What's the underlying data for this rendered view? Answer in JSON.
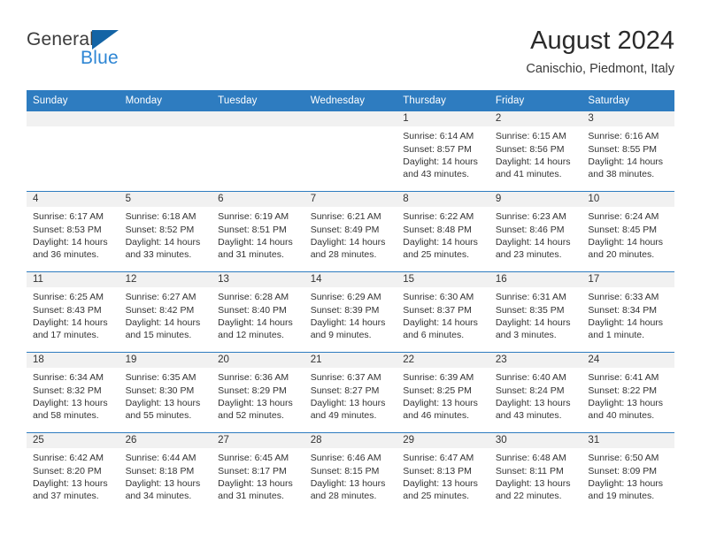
{
  "brand": {
    "word1": "General",
    "word2": "Blue",
    "triangle_color": "#1464a5"
  },
  "header": {
    "title": "August 2024",
    "subtitle": "Canischio, Piedmont, Italy"
  },
  "theme": {
    "header_blue": "#2e7cc0",
    "daynum_strip": "#f1f1f1",
    "text": "#333333"
  },
  "weekdays": [
    "Sunday",
    "Monday",
    "Tuesday",
    "Wednesday",
    "Thursday",
    "Friday",
    "Saturday"
  ],
  "weeks": [
    [
      {
        "empty": true
      },
      {
        "empty": true
      },
      {
        "empty": true
      },
      {
        "empty": true
      },
      {
        "day": "1",
        "sunrise": "Sunrise: 6:14 AM",
        "sunset": "Sunset: 8:57 PM",
        "daylight1": "Daylight: 14 hours",
        "daylight2": "and 43 minutes."
      },
      {
        "day": "2",
        "sunrise": "Sunrise: 6:15 AM",
        "sunset": "Sunset: 8:56 PM",
        "daylight1": "Daylight: 14 hours",
        "daylight2": "and 41 minutes."
      },
      {
        "day": "3",
        "sunrise": "Sunrise: 6:16 AM",
        "sunset": "Sunset: 8:55 PM",
        "daylight1": "Daylight: 14 hours",
        "daylight2": "and 38 minutes."
      }
    ],
    [
      {
        "day": "4",
        "sunrise": "Sunrise: 6:17 AM",
        "sunset": "Sunset: 8:53 PM",
        "daylight1": "Daylight: 14 hours",
        "daylight2": "and 36 minutes."
      },
      {
        "day": "5",
        "sunrise": "Sunrise: 6:18 AM",
        "sunset": "Sunset: 8:52 PM",
        "daylight1": "Daylight: 14 hours",
        "daylight2": "and 33 minutes."
      },
      {
        "day": "6",
        "sunrise": "Sunrise: 6:19 AM",
        "sunset": "Sunset: 8:51 PM",
        "daylight1": "Daylight: 14 hours",
        "daylight2": "and 31 minutes."
      },
      {
        "day": "7",
        "sunrise": "Sunrise: 6:21 AM",
        "sunset": "Sunset: 8:49 PM",
        "daylight1": "Daylight: 14 hours",
        "daylight2": "and 28 minutes."
      },
      {
        "day": "8",
        "sunrise": "Sunrise: 6:22 AM",
        "sunset": "Sunset: 8:48 PM",
        "daylight1": "Daylight: 14 hours",
        "daylight2": "and 25 minutes."
      },
      {
        "day": "9",
        "sunrise": "Sunrise: 6:23 AM",
        "sunset": "Sunset: 8:46 PM",
        "daylight1": "Daylight: 14 hours",
        "daylight2": "and 23 minutes."
      },
      {
        "day": "10",
        "sunrise": "Sunrise: 6:24 AM",
        "sunset": "Sunset: 8:45 PM",
        "daylight1": "Daylight: 14 hours",
        "daylight2": "and 20 minutes."
      }
    ],
    [
      {
        "day": "11",
        "sunrise": "Sunrise: 6:25 AM",
        "sunset": "Sunset: 8:43 PM",
        "daylight1": "Daylight: 14 hours",
        "daylight2": "and 17 minutes."
      },
      {
        "day": "12",
        "sunrise": "Sunrise: 6:27 AM",
        "sunset": "Sunset: 8:42 PM",
        "daylight1": "Daylight: 14 hours",
        "daylight2": "and 15 minutes."
      },
      {
        "day": "13",
        "sunrise": "Sunrise: 6:28 AM",
        "sunset": "Sunset: 8:40 PM",
        "daylight1": "Daylight: 14 hours",
        "daylight2": "and 12 minutes."
      },
      {
        "day": "14",
        "sunrise": "Sunrise: 6:29 AM",
        "sunset": "Sunset: 8:39 PM",
        "daylight1": "Daylight: 14 hours",
        "daylight2": "and 9 minutes."
      },
      {
        "day": "15",
        "sunrise": "Sunrise: 6:30 AM",
        "sunset": "Sunset: 8:37 PM",
        "daylight1": "Daylight: 14 hours",
        "daylight2": "and 6 minutes."
      },
      {
        "day": "16",
        "sunrise": "Sunrise: 6:31 AM",
        "sunset": "Sunset: 8:35 PM",
        "daylight1": "Daylight: 14 hours",
        "daylight2": "and 3 minutes."
      },
      {
        "day": "17",
        "sunrise": "Sunrise: 6:33 AM",
        "sunset": "Sunset: 8:34 PM",
        "daylight1": "Daylight: 14 hours",
        "daylight2": "and 1 minute."
      }
    ],
    [
      {
        "day": "18",
        "sunrise": "Sunrise: 6:34 AM",
        "sunset": "Sunset: 8:32 PM",
        "daylight1": "Daylight: 13 hours",
        "daylight2": "and 58 minutes."
      },
      {
        "day": "19",
        "sunrise": "Sunrise: 6:35 AM",
        "sunset": "Sunset: 8:30 PM",
        "daylight1": "Daylight: 13 hours",
        "daylight2": "and 55 minutes."
      },
      {
        "day": "20",
        "sunrise": "Sunrise: 6:36 AM",
        "sunset": "Sunset: 8:29 PM",
        "daylight1": "Daylight: 13 hours",
        "daylight2": "and 52 minutes."
      },
      {
        "day": "21",
        "sunrise": "Sunrise: 6:37 AM",
        "sunset": "Sunset: 8:27 PM",
        "daylight1": "Daylight: 13 hours",
        "daylight2": "and 49 minutes."
      },
      {
        "day": "22",
        "sunrise": "Sunrise: 6:39 AM",
        "sunset": "Sunset: 8:25 PM",
        "daylight1": "Daylight: 13 hours",
        "daylight2": "and 46 minutes."
      },
      {
        "day": "23",
        "sunrise": "Sunrise: 6:40 AM",
        "sunset": "Sunset: 8:24 PM",
        "daylight1": "Daylight: 13 hours",
        "daylight2": "and 43 minutes."
      },
      {
        "day": "24",
        "sunrise": "Sunrise: 6:41 AM",
        "sunset": "Sunset: 8:22 PM",
        "daylight1": "Daylight: 13 hours",
        "daylight2": "and 40 minutes."
      }
    ],
    [
      {
        "day": "25",
        "sunrise": "Sunrise: 6:42 AM",
        "sunset": "Sunset: 8:20 PM",
        "daylight1": "Daylight: 13 hours",
        "daylight2": "and 37 minutes."
      },
      {
        "day": "26",
        "sunrise": "Sunrise: 6:44 AM",
        "sunset": "Sunset: 8:18 PM",
        "daylight1": "Daylight: 13 hours",
        "daylight2": "and 34 minutes."
      },
      {
        "day": "27",
        "sunrise": "Sunrise: 6:45 AM",
        "sunset": "Sunset: 8:17 PM",
        "daylight1": "Daylight: 13 hours",
        "daylight2": "and 31 minutes."
      },
      {
        "day": "28",
        "sunrise": "Sunrise: 6:46 AM",
        "sunset": "Sunset: 8:15 PM",
        "daylight1": "Daylight: 13 hours",
        "daylight2": "and 28 minutes."
      },
      {
        "day": "29",
        "sunrise": "Sunrise: 6:47 AM",
        "sunset": "Sunset: 8:13 PM",
        "daylight1": "Daylight: 13 hours",
        "daylight2": "and 25 minutes."
      },
      {
        "day": "30",
        "sunrise": "Sunrise: 6:48 AM",
        "sunset": "Sunset: 8:11 PM",
        "daylight1": "Daylight: 13 hours",
        "daylight2": "and 22 minutes."
      },
      {
        "day": "31",
        "sunrise": "Sunrise: 6:50 AM",
        "sunset": "Sunset: 8:09 PM",
        "daylight1": "Daylight: 13 hours",
        "daylight2": "and 19 minutes."
      }
    ]
  ]
}
